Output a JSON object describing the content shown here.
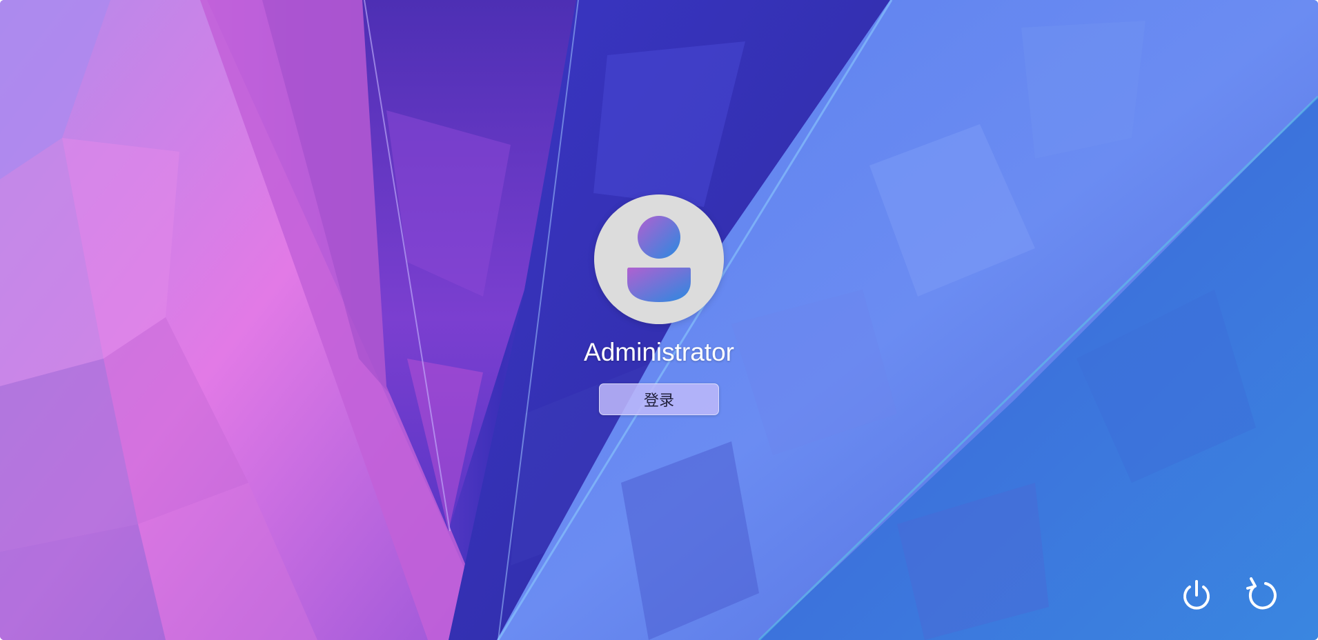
{
  "user": {
    "display_name": "Administrator"
  },
  "login": {
    "button_label": "登录"
  },
  "system_controls": {
    "power_icon": "power-icon",
    "restart_icon": "restart-icon"
  },
  "colors": {
    "avatar_bg": "#dcdcdc",
    "avatar_gradient_start": "#b060d0",
    "avatar_gradient_end": "#2a8ae0",
    "button_bg": "#bebafa",
    "text_light": "#ffffff"
  }
}
